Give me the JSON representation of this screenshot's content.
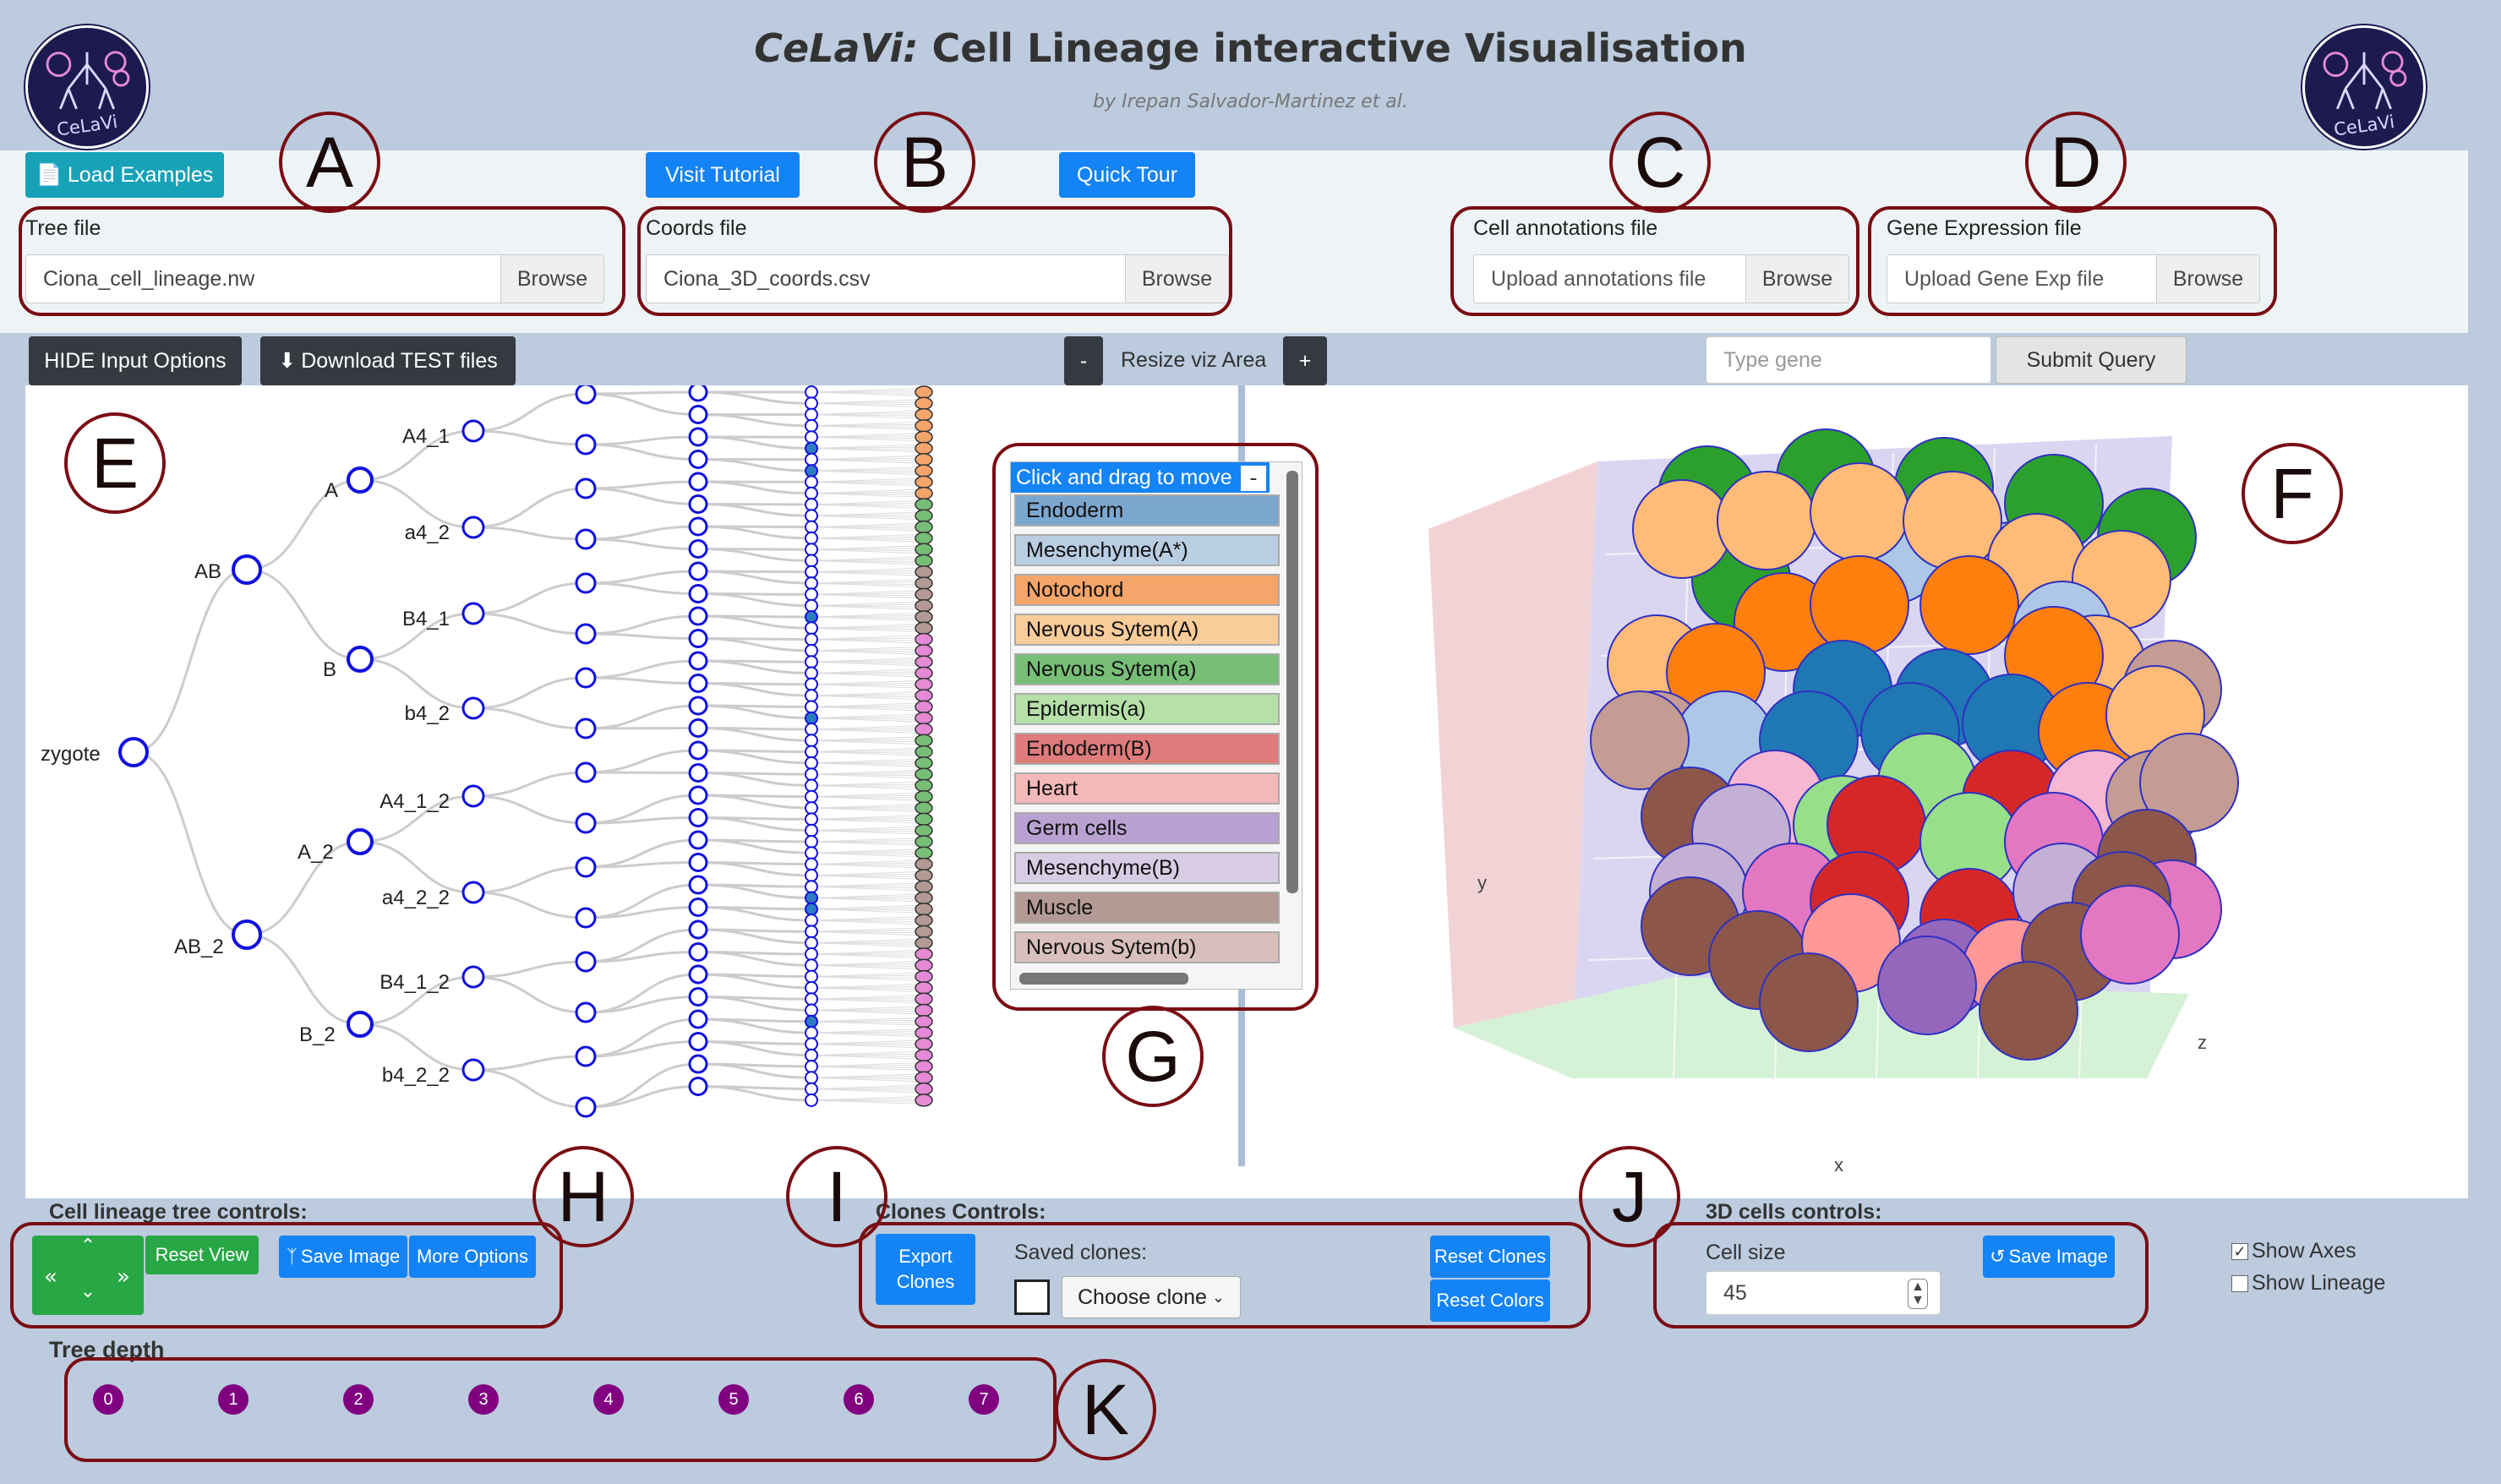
{
  "header": {
    "title_italic": "CeLaVi:",
    "title_rest": "Cell Lineage interactive Visualisation",
    "subtitle": "by Irepan Salvador-Martinez et al.",
    "logo_text": "CeLaVi"
  },
  "inputs": {
    "load_examples": "Load Examples",
    "visit_tutorial": "Visit Tutorial",
    "quick_tour": "Quick Tour",
    "tree_label": "Tree file",
    "tree_value": "Ciona_cell_lineage.nw",
    "coords_label": "Coords file",
    "coords_value": "Ciona_3D_coords.csv",
    "annot_label": "Cell annotations file",
    "annot_placeholder": "Upload annotations file",
    "gene_label": "Gene Expression file",
    "gene_placeholder": "Upload Gene Exp file",
    "browse": "Browse"
  },
  "toolbar": {
    "hide_inputs": "HIDE Input Options",
    "download_test": "Download TEST files",
    "minus": "-",
    "resize": "Resize viz Area",
    "plus": "+",
    "gene_placeholder": "Type gene",
    "submit": "Submit Query"
  },
  "tree": {
    "nodes": [
      "zygote",
      "AB",
      "AB_2",
      "A",
      "B",
      "A_2",
      "B_2",
      "A4_1",
      "a4_2",
      "B4_1",
      "b4_2",
      "A4_1_2",
      "a4_2_2",
      "B4_1_2",
      "b4_2_2"
    ]
  },
  "legend": {
    "header": "Click and drag to move",
    "collapse": "-",
    "items": [
      {
        "label": "Endoderm",
        "color": "#7ba7cf"
      },
      {
        "label": "Mesenchyme(A*)",
        "color": "#b9cde3"
      },
      {
        "label": "Notochord",
        "color": "#f4a56a"
      },
      {
        "label": "Nervous Sytem(A)",
        "color": "#f9cc9a"
      },
      {
        "label": "Nervous Sytem(a)",
        "color": "#77bf77"
      },
      {
        "label": "Epidermis(a)",
        "color": "#b5e0a8"
      },
      {
        "label": "Endoderm(B)",
        "color": "#e07b7b"
      },
      {
        "label": "Heart",
        "color": "#f5b8b8"
      },
      {
        "label": "Germ cells",
        "color": "#b9a2d2"
      },
      {
        "label": "Mesenchyme(B)",
        "color": "#d8cce4"
      },
      {
        "label": "Muscle",
        "color": "#b49a94"
      },
      {
        "label": "Nervous Sytem(b)",
        "color": "#d9bfbc"
      }
    ]
  },
  "plot3d": {
    "axis_x": "x",
    "axis_y": "y",
    "axis_z": "z"
  },
  "tree_controls": {
    "title": "Cell lineage tree controls:",
    "reset_view": "Reset View",
    "save_image": "Save Image",
    "more_options": "More Options",
    "depth_title": "Tree depth",
    "depths": [
      "0",
      "1",
      "2",
      "3",
      "4",
      "5",
      "6",
      "7"
    ]
  },
  "clones": {
    "title": "Clones Controls:",
    "export": "Export Clones",
    "saved": "Saved clones:",
    "choose": "Choose clone",
    "reset_clones": "Reset Clones",
    "reset_colors": "Reset Colors"
  },
  "cells3d": {
    "title": "3D cells controls:",
    "cell_size_label": "Cell size",
    "cell_size": "45",
    "save_image": "Save Image",
    "show_axes": "Show Axes",
    "show_lineage": "Show Lineage"
  },
  "annotations": [
    "A",
    "B",
    "C",
    "D",
    "E",
    "F",
    "G",
    "H",
    "I",
    "J",
    "K"
  ],
  "colors": {
    "brand_blue": "#1483f5",
    "teal": "#17a2b8",
    "annotation": "#7a0d14",
    "depth": "#800080",
    "node": "#1010e0"
  }
}
